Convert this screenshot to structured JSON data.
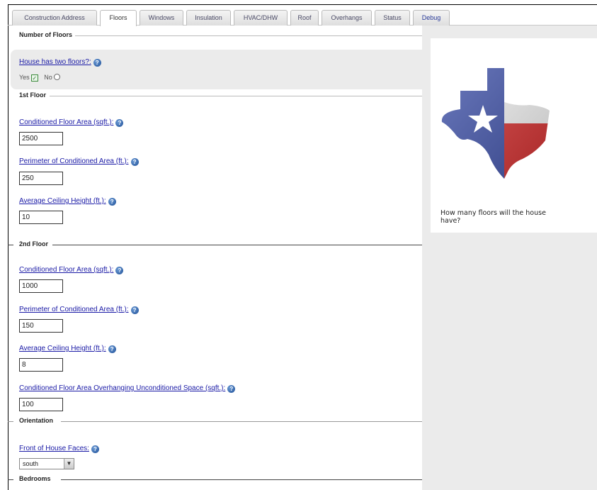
{
  "tabs": [
    {
      "label": "Construction Address"
    },
    {
      "label": "Floors"
    },
    {
      "label": "Windows"
    },
    {
      "label": "Insulation"
    },
    {
      "label": "HVAC/DHW"
    },
    {
      "label": "Roof"
    },
    {
      "label": "Overhangs"
    },
    {
      "label": "Status"
    },
    {
      "label": "Debug"
    }
  ],
  "active_tab": "Floors",
  "sections": {
    "number_of_floors": "Number of Floors",
    "first_floor": "1st Floor",
    "second_floor": "2nd Floor",
    "orientation": "Orientation",
    "bedrooms": "Bedrooms"
  },
  "two_floors": {
    "label": "House has two floors?:",
    "yes_label": "Yes",
    "no_label": "No",
    "selected": "Yes"
  },
  "first_floor": {
    "area_label": "Conditioned Floor Area (sqft.):",
    "area_value": "2500",
    "perimeter_label": "Perimeter of Conditioned Area (ft.):",
    "perimeter_value": "250",
    "height_label": "Average Ceiling Height (ft.):",
    "height_value": "10"
  },
  "second_floor": {
    "area_label": "Conditioned Floor Area (sqft.):",
    "area_value": "1000",
    "perimeter_label": "Perimeter of Conditioned Area (ft.):",
    "perimeter_value": "150",
    "height_label": "Average Ceiling Height (ft.):",
    "height_value": "8",
    "overhang_label": "Conditioned Floor Area Overhanging Unconditioned Space (sqft.):",
    "overhang_value": "100"
  },
  "orientation": {
    "label": "Front of House Faces:",
    "selected": "south"
  },
  "help_panel": {
    "text": "How many floors will the house have?",
    "image": "texas-flag-map"
  },
  "colors": {
    "link": "#1a1aa6",
    "panel_bg": "#ebebeb",
    "flag_blue": "#3b4ea8",
    "flag_red": "#d62a2a"
  }
}
